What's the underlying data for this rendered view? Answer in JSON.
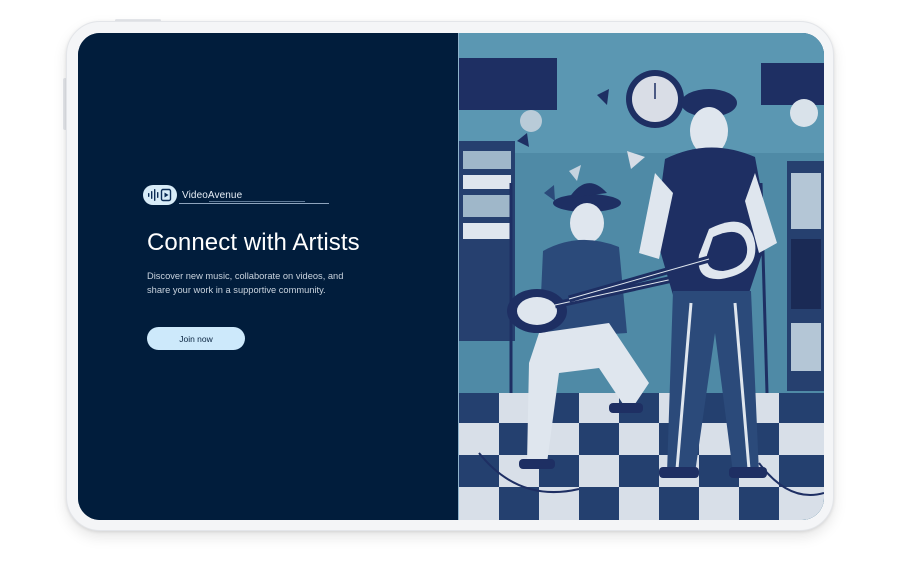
{
  "brand": {
    "name": "VideoAvenue",
    "logo_icon": "sound-wave-icon"
  },
  "hero": {
    "title": "Connect with Artists",
    "description": "Discover new music, collaborate on videos, and share your work in a supportive community.",
    "cta_label": "Join now"
  },
  "illustration": {
    "subject": "two-musicians-playing-guitars-illustration"
  },
  "colors": {
    "left_background": "#011d3c",
    "cta_background": "#cde9fb",
    "illustration_sky": "#4f8aa6",
    "illustration_dark": "#1e2f63"
  }
}
